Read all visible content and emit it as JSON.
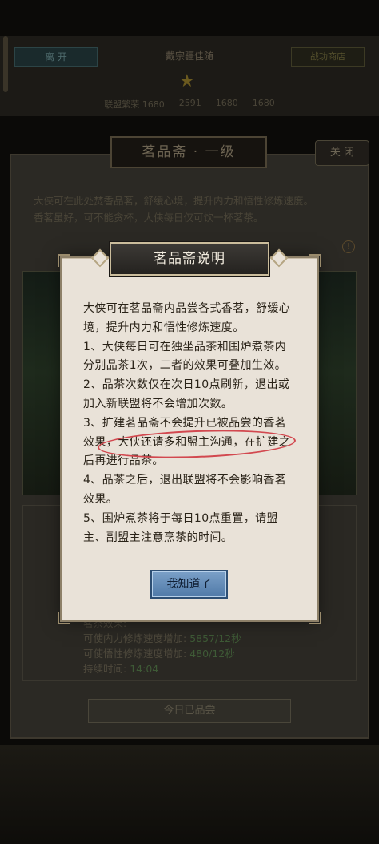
{
  "background": {
    "top_bar": {
      "back_label": "离 开",
      "title": "戴宗疆佳随",
      "right_label": "战功商店",
      "stats": [
        {
          "label": "联盟繁荣",
          "value": "1680"
        },
        {
          "label": "",
          "value": "2591"
        },
        {
          "label": "",
          "value": "1680"
        },
        {
          "label": "",
          "value": "1680"
        }
      ]
    },
    "panel_title": "茗品斋 · 一级",
    "close_label": "关 闭",
    "description": "大侠可在此处焚香品茗，舒缓心境，提升内力和悟性修炼速度。\n香茗虽好，可不能贪杯，大侠每日仅可饮一杯茗茶。",
    "info_icon": "!",
    "effects": [
      {
        "label": "茗茶效果:",
        "value": ""
      },
      {
        "label": "可使内力修炼速度增加:",
        "value": "5857/12秒"
      },
      {
        "label": "可使悟性修炼速度增加:",
        "value": "480/12秒"
      },
      {
        "label": "持续时间:",
        "value": "14:04"
      }
    ],
    "tasted_button": "今日已品尝"
  },
  "modal": {
    "title": "茗品斋说明",
    "paragraphs": [
      "大侠可在茗品斋内品尝各式香茗，舒缓心境，提升内力和悟性修炼速度。",
      "1、大侠每日可在独坐品茶和围炉煮茶内分别品茶1次，二者的效果可叠加生效。",
      "2、品茶次数仅在次日10点刷新，退出或加入新联盟将不会增加次数。",
      "3、扩建茗品斋不会提升已被品尝的香茗效果，大侠还请多和盟主沟通，在扩建之后再进行品茶。",
      "4、品茶之后，退出联盟将不会影响香茗效果。",
      "5、围炉煮茶将于每日10点重置，请盟主、副盟主注意烹茶的时间。"
    ],
    "ok_button": "我知道了"
  },
  "colors": {
    "modal_bg": "#e9e2d8",
    "highlight": "#d2484f",
    "ok_button": "#5f87b4",
    "effect_value": "#3e5a36"
  }
}
